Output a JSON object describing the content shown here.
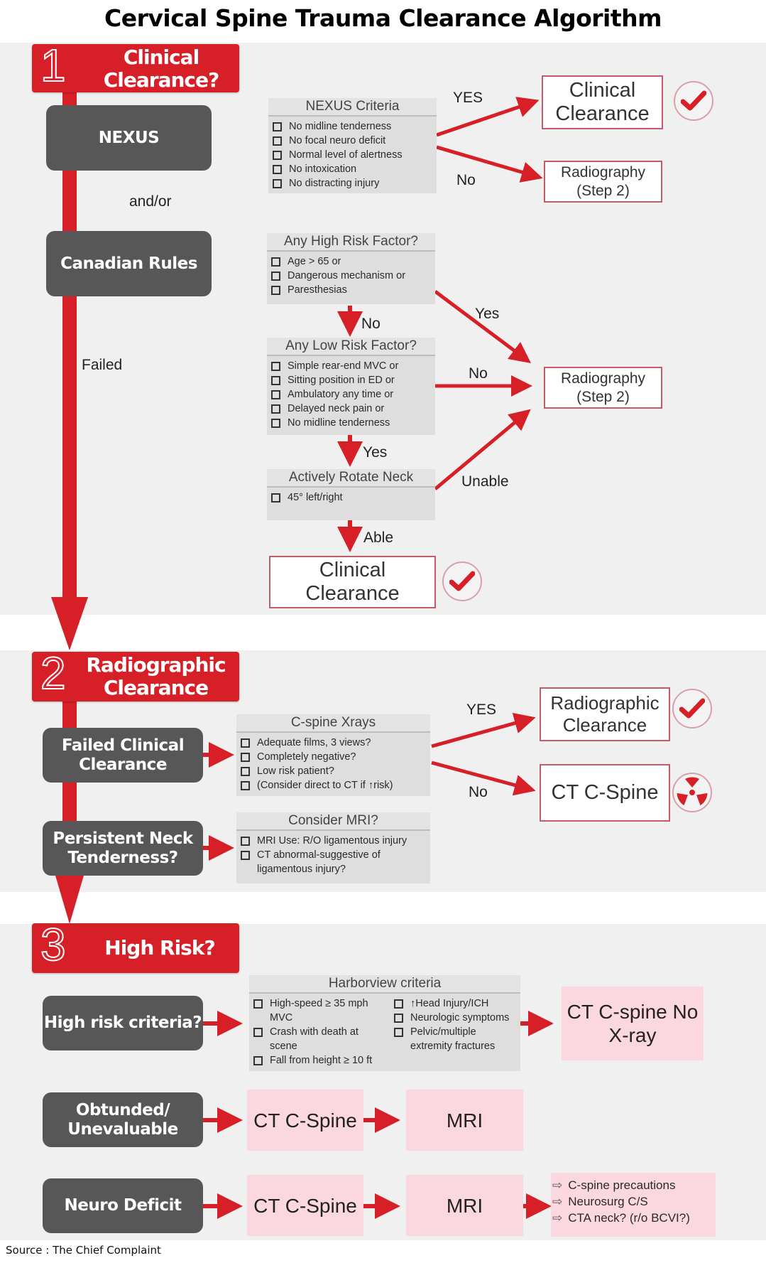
{
  "title": "Cervical Spine Trauma Clearance Algorithm",
  "source": "Source : The Chief Complaint",
  "colors": {
    "accent_red": "#d61f26",
    "dark_box": "#575757",
    "criteria_bg": "#dedede",
    "pink_box": "#fbd7df",
    "band_bg": "#f0f0f0"
  },
  "step1": {
    "number": "1",
    "label": "Clinical Clearance?",
    "nexus_box": "NEXUS",
    "and_or": "and/or",
    "canadian_box": "Canadian Rules",
    "failed_label": "Failed",
    "nexus_criteria": {
      "title": "NEXUS Criteria",
      "items": [
        "No midline tenderness",
        "No focal neuro deficit",
        "Normal level of alertness",
        "No intoxication",
        "No distracting injury"
      ]
    },
    "nexus_yes": "YES",
    "nexus_no": "No",
    "nexus_yes_outcome": "Clinical Clearance",
    "nexus_no_outcome": "Radiography (Step 2)",
    "high_risk": {
      "title": "Any High Risk Factor?",
      "items": [
        "Age > 65 or",
        "Dangerous mechanism or",
        "Paresthesias"
      ]
    },
    "high_risk_no": "No",
    "high_risk_yes": "Yes",
    "low_risk": {
      "title": "Any Low Risk Factor?",
      "items": [
        "Simple rear-end MVC or",
        "Sitting position in ED or",
        "Ambulatory any time or",
        "Delayed neck pain or",
        "No midline tenderness"
      ]
    },
    "low_risk_yes": "Yes",
    "low_risk_no": "No",
    "rotate": {
      "title": "Actively Rotate Neck",
      "items": [
        "45° left/right"
      ]
    },
    "rotate_unable": "Unable",
    "rotate_able": "Able",
    "canadian_radiography": "Radiography (Step 2)",
    "canadian_clearance": "Clinical Clearance",
    "icons": [
      "check-circle-icon",
      "check-circle-icon"
    ]
  },
  "step2": {
    "number": "2",
    "label": "Radiographic Clearance",
    "failed_box": "Failed Clinical Clearance",
    "persistent_box": "Persistent Neck Tenderness?",
    "xrays": {
      "title": "C-spine Xrays",
      "items": [
        "Adequate films, 3 views?",
        "Completely negative?",
        "Low risk patient?",
        "(Consider direct to CT if ↑risk)"
      ]
    },
    "xray_yes": "YES",
    "xray_no": "No",
    "yes_outcome": "Radiographic Clearance",
    "no_outcome": "CT C-Spine",
    "mri": {
      "title": "Consider MRI?",
      "items": [
        "MRI Use: R/O ligamentous injury",
        "CT abnormal-suggestive of ligamentous injury?"
      ]
    },
    "icons": [
      "check-circle-icon",
      "radiation-icon"
    ]
  },
  "step3": {
    "number": "3",
    "label": "High Risk?",
    "high_risk_box": "High risk criteria?",
    "harborview": {
      "title": "Harborview criteria",
      "left_items": [
        "High-speed ≥ 35 mph MVC",
        "Crash with death at scene",
        "Fall from height ≥ 10 ft"
      ],
      "right_items": [
        "↑Head Injury/ICH",
        "Neurologic symptoms",
        "Pelvic/multiple extremity fractures"
      ]
    },
    "high_risk_outcome": "CT C-spine No X-ray",
    "obtunded_box": "Obtunded/ Unevaluable",
    "obtunded_ct": "CT C-Spine",
    "obtunded_mri": "MRI",
    "neuro_box": "Neuro Deficit",
    "neuro_ct": "CT C-Spine",
    "neuro_mri": "MRI",
    "neuro_next": [
      "C-spine precautions",
      "Neurosurg C/S",
      "CTA neck? (r/o BCVI?)"
    ]
  }
}
